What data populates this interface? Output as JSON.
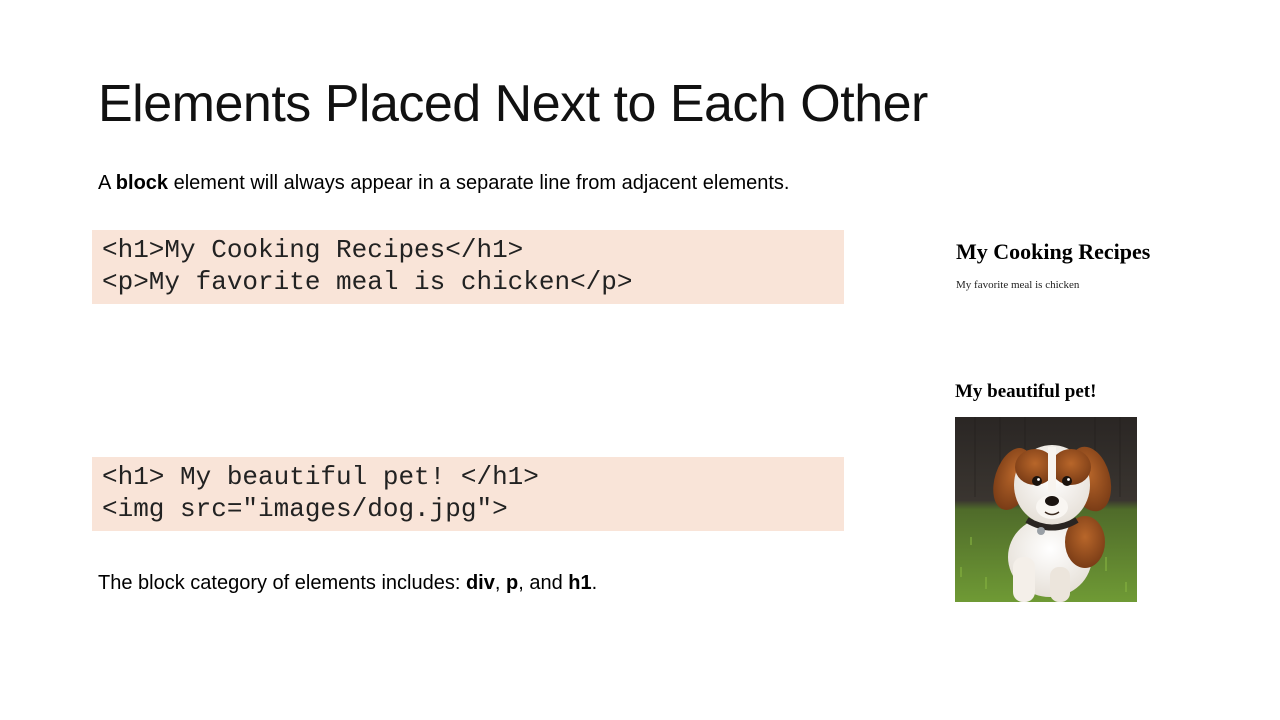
{
  "slide": {
    "title": "Elements Placed Next to Each Other",
    "intro": {
      "prefix": "A ",
      "bold": "block",
      "suffix": " element will always appear in a separate line from adjacent elements."
    },
    "code_example_1": [
      "<h1>My Cooking Recipes</h1>",
      "<p>My favorite meal is chicken</p>"
    ],
    "code_example_2": [
      "<h1> My beautiful pet! </h1>",
      "<img src=\"images/dog.jpg\">"
    ],
    "summary": {
      "prefix": "The block category of elements includes: ",
      "item1": "div",
      "sep1": ", ",
      "item2": "p",
      "sep2": ", and ",
      "item3": "h1",
      "suffix": "."
    }
  },
  "preview": {
    "heading_1": "My Cooking Recipes",
    "paragraph": "My favorite meal is chicken",
    "heading_2": "My beautiful pet!",
    "image_icon": "dog-photo"
  },
  "colors": {
    "code_background": "#f9e4d8",
    "text": "#000000"
  }
}
